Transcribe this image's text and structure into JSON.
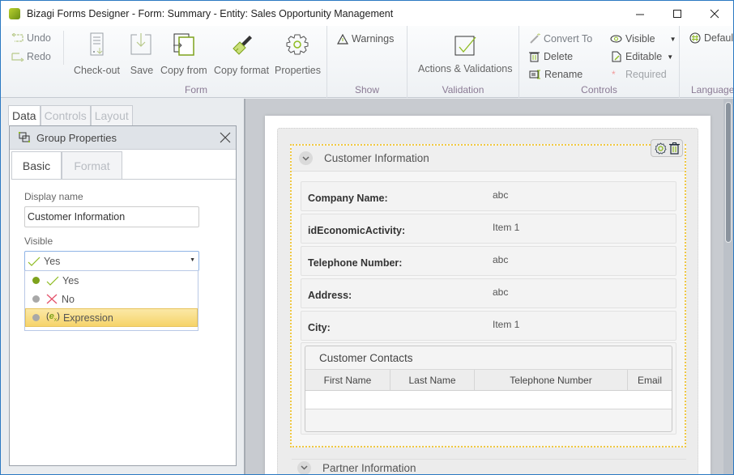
{
  "window": {
    "title": "Bizagi Forms Designer  - Form: Summary - Entity:  Sales Opportunity Management",
    "minimize_icon": "minimize-icon",
    "maximize_icon": "maximize-icon",
    "close_icon": "close-icon"
  },
  "ribbon": {
    "history": {
      "undo": "Undo",
      "redo": "Redo"
    },
    "form_group": {
      "label": "Form",
      "buttons": [
        {
          "label": "Check-out",
          "icon": "checkout-icon"
        },
        {
          "label": "Save",
          "icon": "save-icon"
        },
        {
          "label": "Copy from",
          "icon": "copy-from-icon"
        },
        {
          "label": "Copy format",
          "icon": "paintbrush-icon"
        },
        {
          "label": "Properties",
          "icon": "gear-icon"
        }
      ]
    },
    "show_group": {
      "label": "Show",
      "warnings": "Warnings"
    },
    "validation_group": {
      "label": "Validation",
      "actions": "Actions & Validations"
    },
    "controls_group": {
      "label": "Controls",
      "convert_to": "Convert To",
      "delete": "Delete",
      "rename": "Rename",
      "visible": "Visible",
      "editable": "Editable",
      "required": "Required"
    },
    "language_group": {
      "label": "Language",
      "default": "Default"
    }
  },
  "left_panel": {
    "tabs": [
      {
        "label": "Data",
        "active": true
      },
      {
        "label": "Controls",
        "active": false
      },
      {
        "label": "Layout",
        "active": false
      }
    ],
    "properties": {
      "title": "Group Properties",
      "tabs": [
        {
          "label": "Basic",
          "active": true
        },
        {
          "label": "Format",
          "active": false
        }
      ],
      "display_name_label": "Display name",
      "display_name_value": "Customer Information",
      "visible_label": "Visible",
      "visible_value": "Yes",
      "visible_options": [
        {
          "label": "Yes",
          "icon": "checkmark-icon",
          "state": "active"
        },
        {
          "label": "No",
          "icon": "x-icon",
          "state": "inactive"
        },
        {
          "label": "Expression",
          "icon": "expression-icon",
          "state": "highlighted"
        }
      ]
    }
  },
  "form": {
    "group": {
      "title": "Customer Information",
      "fields": [
        {
          "label": "Company Name:",
          "value": "abc"
        },
        {
          "label": "idEconomicActivity:",
          "value": "Item 1"
        },
        {
          "label": "Telephone Number:",
          "value": "abc"
        },
        {
          "label": "Address:",
          "value": "abc"
        },
        {
          "label": "City:",
          "value": "Item 1"
        }
      ],
      "grid": {
        "title": "Customer Contacts",
        "columns": [
          "First Name",
          "Last Name",
          "Telephone Number",
          "Email"
        ]
      }
    },
    "next_group": {
      "title": "Partner Information"
    }
  },
  "colors": {
    "accent_green": "#8dbb1f",
    "selection_yellow": "#f0c843",
    "window_border": "#2b79c2"
  }
}
